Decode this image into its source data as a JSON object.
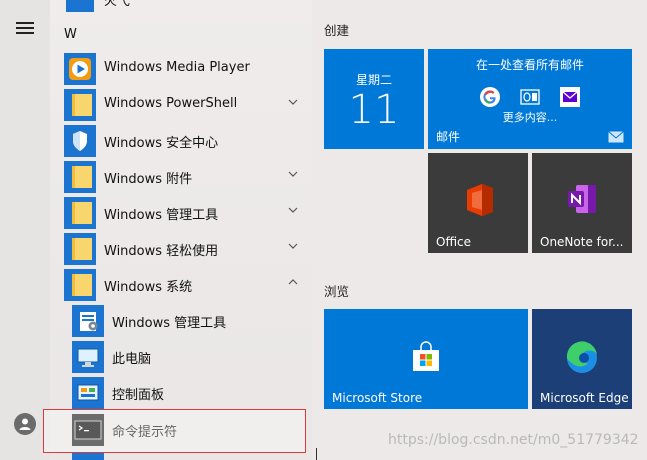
{
  "colors": {
    "tile_blue": "#0078d7",
    "tile_dark": "#3b3b3b",
    "edge_tile": "#1c3f78",
    "selection_border": "#dd3a3a",
    "folder_yellow": "#f8d56d"
  },
  "partial_top_label": "火弋",
  "section_letter": "W",
  "apps": [
    {
      "label": "Windows Media Player",
      "icon": "media-player-icon",
      "expand": "none"
    },
    {
      "label": "Windows PowerShell",
      "icon": "folder-icon",
      "expand": "down"
    },
    {
      "label": "Windows 安全中心",
      "icon": "shield-icon",
      "expand": "none"
    },
    {
      "label": "Windows 附件",
      "icon": "folder-icon",
      "expand": "down"
    },
    {
      "label": "Windows 管理工具",
      "icon": "folder-icon",
      "expand": "down"
    },
    {
      "label": "Windows 轻松使用",
      "icon": "folder-icon",
      "expand": "down"
    },
    {
      "label": "Windows 系统",
      "icon": "folder-icon",
      "expand": "up"
    }
  ],
  "sub_apps": [
    {
      "label": "Windows 管理工具",
      "icon": "admin-tools-icon"
    },
    {
      "label": "此电脑",
      "icon": "this-pc-icon"
    },
    {
      "label": "控制面板",
      "icon": "control-panel-icon"
    },
    {
      "label": "命令提示符",
      "icon": "cmd-icon"
    }
  ],
  "groups": {
    "create": "创建",
    "browse": "浏览"
  },
  "tiles": {
    "calendar": {
      "day": "星期二",
      "date": "11"
    },
    "mail": {
      "heading": "在一处查看所有邮件",
      "more": "更多内容...",
      "label": "邮件"
    },
    "office": {
      "label": "Office"
    },
    "onenote": {
      "label": "OneNote for..."
    },
    "store": {
      "label": "Microsoft Store"
    },
    "edge": {
      "label": "Microsoft Edge"
    }
  },
  "watermark": "https://blog.csdn.net/m0_51779342"
}
